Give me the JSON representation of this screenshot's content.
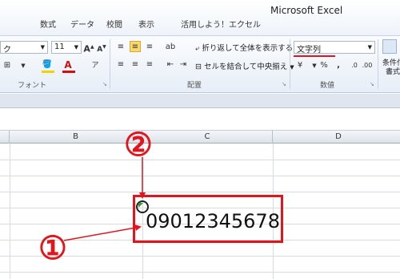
{
  "window": {
    "title": "Microsoft Excel"
  },
  "tabs": [
    "数式",
    "データ",
    "校閲",
    "表示",
    "活用しよう！エクセル"
  ],
  "ribbon": {
    "font_name_partial": "ク",
    "font_size": "11",
    "wrap_text_label": "折り返して全体を表示する",
    "merge_center_label": "セルを結合して中央揃え",
    "number_format": "文字列",
    "groups": {
      "font": "フォント",
      "alignment": "配置",
      "number": "数値"
    },
    "conditional_partial_1": "条件付",
    "conditional_partial_2": "書式"
  },
  "columns": [
    "B",
    "C",
    "D"
  ],
  "cell": {
    "value": "09012345678"
  },
  "annotations": {
    "one": "①",
    "two": "②"
  },
  "colors": {
    "highlight": "#e2141c",
    "error_indicator": "#2f9c32"
  }
}
